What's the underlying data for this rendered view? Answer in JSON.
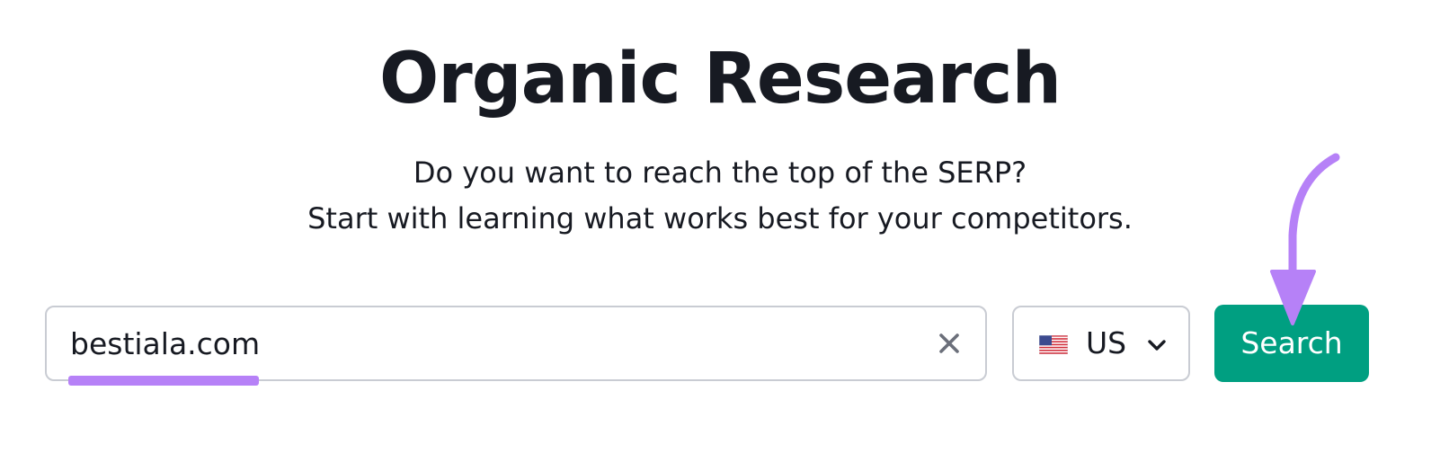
{
  "header": {
    "title": "Organic Research",
    "subtitle_line1": "Do you want to reach the top of the SERP?",
    "subtitle_line2": "Start with learning what works best for your competitors."
  },
  "search": {
    "domain_value": "bestiala.com",
    "clear_icon": "close-icon",
    "country": {
      "flag_icon": "us-flag-icon",
      "selected": "US",
      "chevron_icon": "chevron-down-icon"
    },
    "button_label": "Search"
  },
  "annotations": {
    "underline_color": "#b681f7",
    "arrow_icon": "arrow-down-icon",
    "arrow_color": "#b681f7"
  },
  "colors": {
    "primary_button": "#009f81",
    "text": "#171a22",
    "border": "#c9ccd3"
  }
}
